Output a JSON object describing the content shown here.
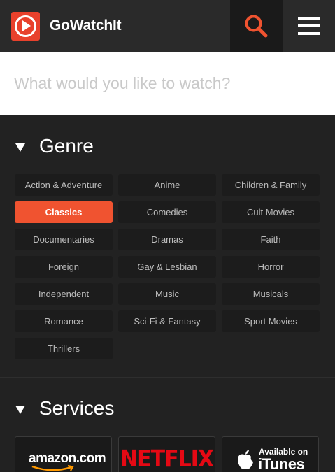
{
  "header": {
    "brand": "GoWatchIt",
    "logo_icon": "play-icon",
    "search_icon": "search-icon",
    "menu_icon": "hamburger-menu-icon"
  },
  "search": {
    "placeholder": "What would you like to watch?",
    "value": ""
  },
  "genre": {
    "title": "Genre",
    "items": [
      {
        "label": "Action & Adventure",
        "active": false
      },
      {
        "label": "Anime",
        "active": false
      },
      {
        "label": "Children & Family",
        "active": false
      },
      {
        "label": "Classics",
        "active": true
      },
      {
        "label": "Comedies",
        "active": false
      },
      {
        "label": "Cult Movies",
        "active": false
      },
      {
        "label": "Documentaries",
        "active": false
      },
      {
        "label": "Dramas",
        "active": false
      },
      {
        "label": "Faith",
        "active": false
      },
      {
        "label": "Foreign",
        "active": false
      },
      {
        "label": "Gay & Lesbian",
        "active": false
      },
      {
        "label": "Horror",
        "active": false
      },
      {
        "label": "Independent",
        "active": false
      },
      {
        "label": "Music",
        "active": false
      },
      {
        "label": "Musicals",
        "active": false
      },
      {
        "label": "Romance",
        "active": false
      },
      {
        "label": "Sci-Fi & Fantasy",
        "active": false
      },
      {
        "label": "Sport Movies",
        "active": false
      },
      {
        "label": "Thrillers",
        "active": false
      }
    ]
  },
  "services": {
    "title": "Services",
    "items": [
      {
        "name": "amazon.com",
        "logo_icon": "amazon-logo"
      },
      {
        "name": "NETFLIX",
        "logo_icon": "netflix-logo"
      },
      {
        "name": "iTunes",
        "tagline": "Available on",
        "logo_icon": "apple-logo"
      }
    ]
  },
  "colors": {
    "accent": "#f05330",
    "logo_red": "#e8412c",
    "netflix_red": "#e50914",
    "background": "#222222",
    "header": "#2a2a2a"
  }
}
